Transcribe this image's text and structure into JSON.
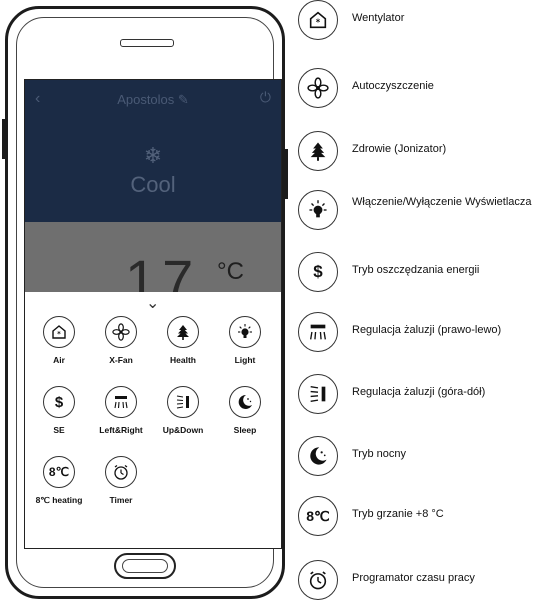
{
  "app": {
    "title": "Apostolos ✎",
    "back_icon": "back-arrow-icon",
    "power_icon": "power-icon",
    "mode_icon": "snowflake-icon",
    "mode": "Cool",
    "temperature": "17",
    "unit": "°C",
    "expand_icon": "chevron-down-icon"
  },
  "buttons": [
    {
      "label": "Air",
      "icon": "house-snow-icon"
    },
    {
      "label": "X-Fan",
      "icon": "fan-icon"
    },
    {
      "label": "Health",
      "icon": "tree-icon"
    },
    {
      "label": "Light",
      "icon": "bulb-icon"
    },
    {
      "label": "SE",
      "icon": "dollar-icon",
      "symbol": "$"
    },
    {
      "label": "Left&Right",
      "icon": "louver-horizontal-icon"
    },
    {
      "label": "Up&Down",
      "icon": "louver-vertical-icon"
    },
    {
      "label": "Sleep",
      "icon": "moon-stars-icon"
    },
    {
      "label": "8℃ heating",
      "icon": "eight-degree-icon",
      "symbol": "8℃"
    },
    {
      "label": "Timer",
      "icon": "alarm-clock-icon"
    }
  ],
  "legend": [
    {
      "label": "Wentylator",
      "icon": "house-snow-icon"
    },
    {
      "label": "Autoczyszczenie",
      "icon": "fan-icon"
    },
    {
      "label": "Zdrowie (Jonizator)",
      "icon": "tree-icon"
    },
    {
      "label": "Włączenie/Wyłączenie Wyświetlacza",
      "icon": "bulb-icon"
    },
    {
      "label": "Tryb oszczędzania energii",
      "icon": "dollar-icon",
      "symbol": "$"
    },
    {
      "label": "Regulacja żaluzji (prawo-lewo)",
      "icon": "louver-horizontal-icon"
    },
    {
      "label": "Regulacja żaluzji (góra-dół)",
      "icon": "louver-vertical-icon"
    },
    {
      "label": "Tryb nocny",
      "icon": "moon-stars-icon"
    },
    {
      "label": "Tryb grzanie +8 °C",
      "icon": "eight-degree-icon",
      "symbol": "8℃"
    },
    {
      "label": "Programator czasu pracy",
      "icon": "alarm-clock-icon"
    }
  ]
}
